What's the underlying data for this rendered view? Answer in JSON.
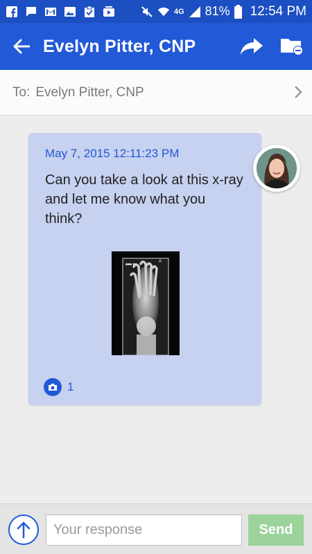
{
  "status_bar": {
    "icons": [
      "facebook-icon",
      "chat-icon",
      "gmail-icon",
      "gallery-icon",
      "clipboard-icon",
      "video-icon",
      "mute-icon",
      "wifi-icon",
      "lte-signal-icon",
      "battery-icon"
    ],
    "network": "4G",
    "battery": "81%",
    "time": "12:54 PM"
  },
  "app_bar": {
    "title": "Evelyn Pitter, CNP",
    "actions": [
      "forward-icon",
      "folder-remove-icon"
    ]
  },
  "recipient": {
    "label": "To:",
    "name": "Evelyn Pitter, CNP"
  },
  "message": {
    "date": "May 7, 2015 12:11:23 PM",
    "text": "Can you take a look at this x-ray and let me know what you think?",
    "attachment_count": "1"
  },
  "composer": {
    "placeholder": "Your response",
    "value": "",
    "send_label": "Send"
  },
  "colors": {
    "status_bar": "#1c4fc2",
    "app_bar": "#2259d6",
    "bubble": "#c7d1f0",
    "send_button": "#9bd39a"
  }
}
